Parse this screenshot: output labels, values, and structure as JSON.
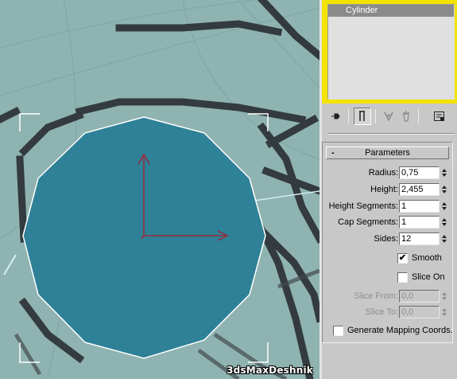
{
  "modifier_stack": {
    "items": [
      "Cylinder"
    ],
    "selected": "Cylinder"
  },
  "toolbar": {
    "icons": [
      "pin-stack-icon",
      "show-end-result-icon",
      "make-unique-icon",
      "remove-modifier-icon",
      "configure-modifier-sets-icon"
    ]
  },
  "parameters": {
    "title": "Parameters",
    "collapse_symbol": "-",
    "radius": {
      "label": "Radius:",
      "value": "0,75"
    },
    "height": {
      "label": "Height:",
      "value": "2,455"
    },
    "height_segments": {
      "label": "Height Segments:",
      "value": "1"
    },
    "cap_segments": {
      "label": "Cap Segments:",
      "value": "1"
    },
    "sides": {
      "label": "Sides:",
      "value": "12"
    },
    "smooth": {
      "label": "Smooth",
      "checked": true,
      "mark": "✔"
    },
    "slice_on": {
      "label": "Slice On",
      "checked": false
    },
    "slice_from": {
      "label": "Slice From:",
      "value": "0,0",
      "enabled": false
    },
    "slice_to": {
      "label": "Slice To:",
      "value": "0,0",
      "enabled": false
    },
    "mapping": {
      "label": "Generate Mapping Coords.",
      "checked": false
    }
  },
  "viewport": {
    "object_color": "#2e8197",
    "background_color": "#8fb3b0",
    "axis_color": "#9b2a3a",
    "watermark": "3dsMaxDeshnik"
  }
}
